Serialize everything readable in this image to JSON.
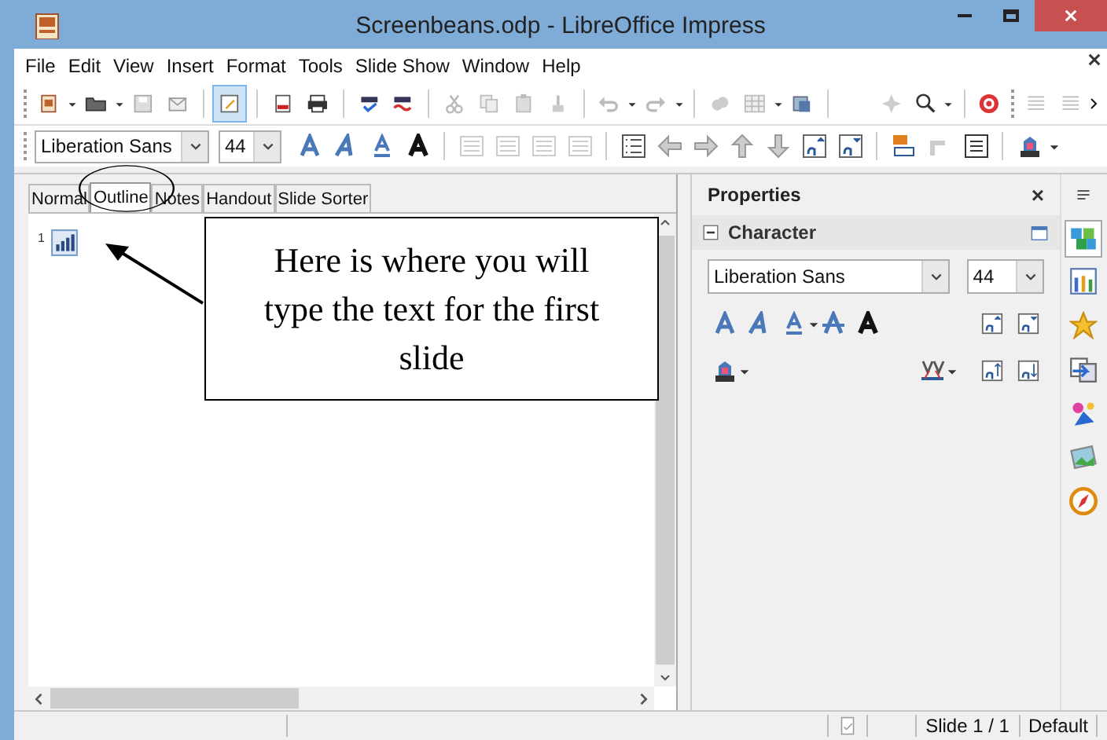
{
  "window": {
    "title": "Screenbeans.odp - LibreOffice Impress"
  },
  "menu": [
    "File",
    "Edit",
    "View",
    "Insert",
    "Format",
    "Tools",
    "Slide Show",
    "Window",
    "Help"
  ],
  "formatting_toolbar": {
    "font": "Liberation Sans",
    "size": "44"
  },
  "tabs": [
    {
      "label": "Normal",
      "selected": false
    },
    {
      "label": "Outline",
      "selected": true
    },
    {
      "label": "Notes",
      "selected": false
    },
    {
      "label": "Handout",
      "selected": false
    },
    {
      "label": "Slide Sorter",
      "selected": false
    }
  ],
  "outline": [
    {
      "number": "1"
    }
  ],
  "callout": {
    "text": "Here is where you will type the text for the first slide"
  },
  "properties": {
    "title": "Properties",
    "close": "×",
    "section": "Character",
    "font": "Liberation Sans",
    "size": "44"
  },
  "status_bar": {
    "slide": "Slide 1 / 1",
    "layout": "Default"
  }
}
